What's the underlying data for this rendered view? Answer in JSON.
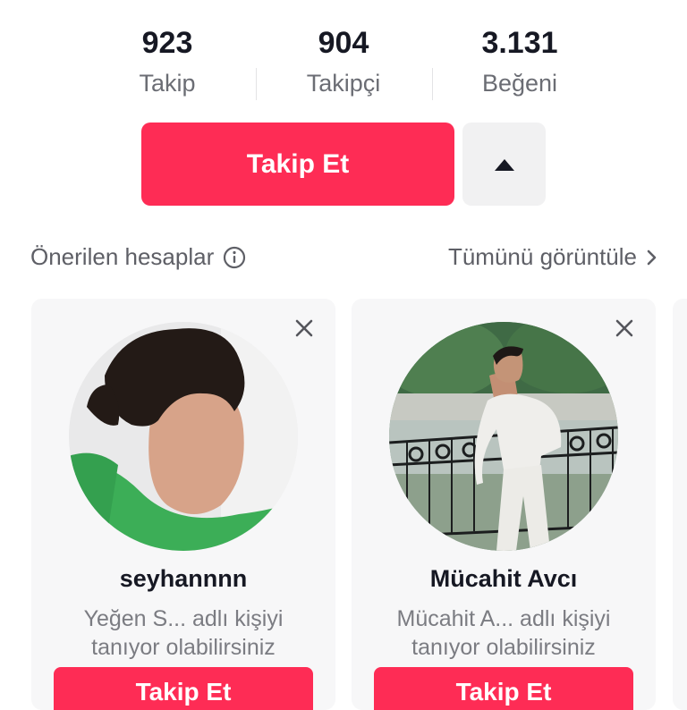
{
  "stats": {
    "following": {
      "value": "923",
      "label": "Takip"
    },
    "followers": {
      "value": "904",
      "label": "Takipçi"
    },
    "likes": {
      "value": "3.131",
      "label": "Beğeni"
    }
  },
  "actions": {
    "follow_label": "Takip Et",
    "toggle_icon": "caret-up-icon"
  },
  "suggested": {
    "title": "Önerilen hesaplar",
    "info_icon": "info-icon",
    "view_all_label": "Tümünü görüntüle",
    "view_all_icon": "chevron-right-icon",
    "cards": [
      {
        "username": "seyhannnn",
        "hint_line1": "Yeğen S... adlı kişiyi",
        "hint_line2": "tanıyor olabilirsiniz",
        "follow_label": "Takip Et"
      },
      {
        "username": "Mücahit Avcı",
        "hint_line1": "Mücahit A... adlı kişiyi",
        "hint_line2": "tanıyor olabilirsiniz",
        "follow_label": "Takip Et"
      }
    ]
  },
  "colors": {
    "accent": "#fe2c55",
    "text_primary": "#161823",
    "text_secondary": "#6b6d74",
    "card_bg": "#f7f7f8"
  }
}
